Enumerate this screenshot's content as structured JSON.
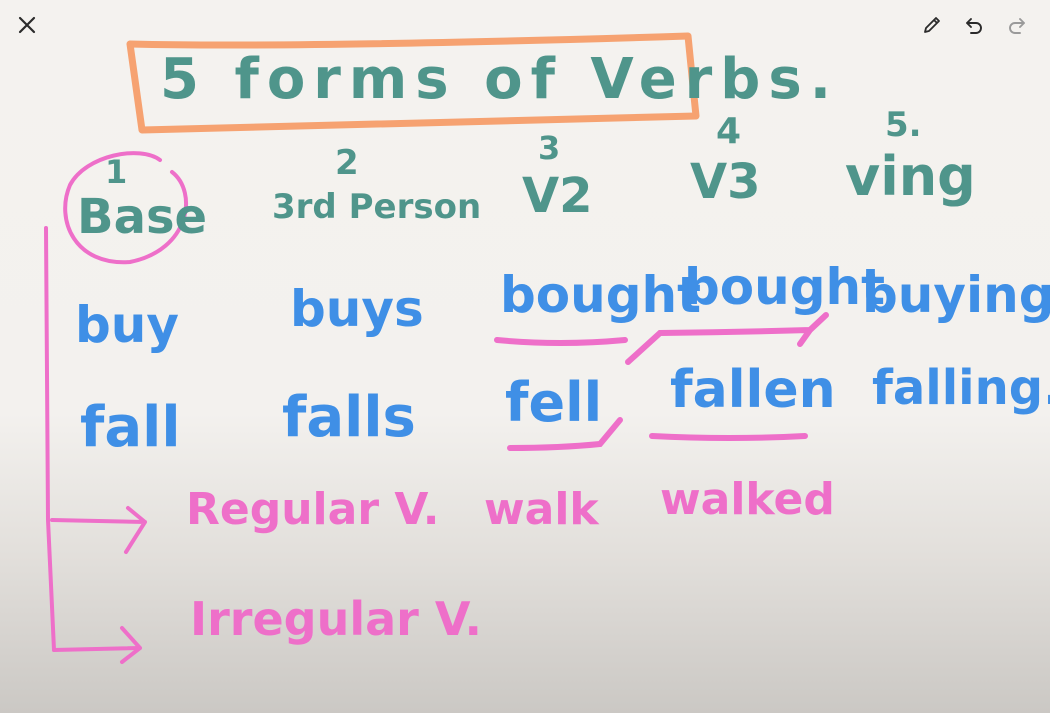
{
  "toolbar": {
    "close_icon": "close-icon",
    "pen_icon": "pencil-icon",
    "undo_icon": "undo-icon",
    "redo_icon": "redo-icon"
  },
  "board": {
    "title": "5 forms of Verbs.",
    "headers": [
      {
        "num": "1",
        "label": "Base"
      },
      {
        "num": "2",
        "label": "3rd Person"
      },
      {
        "num": "3",
        "label": "V2"
      },
      {
        "num": "4",
        "label": "V3"
      },
      {
        "num": "5.",
        "label": "Ving"
      }
    ],
    "rows": [
      [
        "buy",
        "buys",
        "bought",
        "bought",
        "buying"
      ],
      [
        "fall",
        "falls",
        "fell",
        "fallen",
        "falling."
      ]
    ],
    "regular": {
      "label": "Regular V.",
      "base": "walk",
      "past": "walked"
    },
    "irregular": {
      "label": "Irregular V."
    }
  },
  "colors": {
    "title_box": "#f6a271",
    "headers": "#4f958b",
    "words": "#3f8fe6",
    "annotation": "#ee6fc9"
  }
}
